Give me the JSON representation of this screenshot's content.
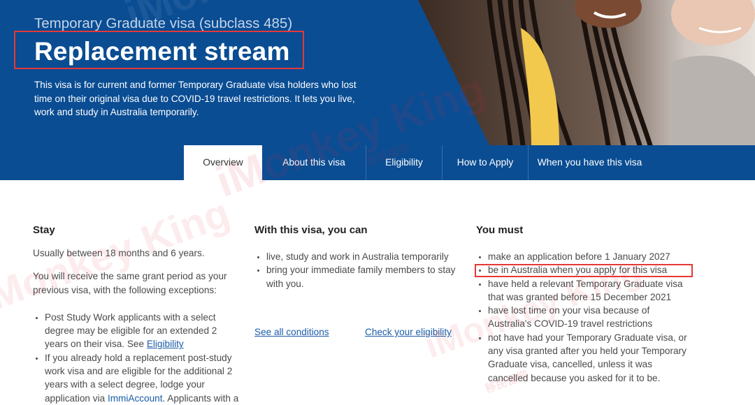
{
  "hero": {
    "subtitle": "Temporary Graduate visa (subclass 485)",
    "title": "Replacement stream",
    "description": "This visa is for current and former Temporary Graduate visa holders who lost time on their original visa due to COVID-19 travel restrictions. It lets you live, work and study in Australia temporarily."
  },
  "tabs": [
    {
      "label": "Overview",
      "active": true
    },
    {
      "label": "About this visa",
      "active": false
    },
    {
      "label": "Eligibility",
      "active": false
    },
    {
      "label": "How to Apply",
      "active": false
    },
    {
      "label": "When you have this visa",
      "active": false
    }
  ],
  "stay": {
    "heading": "Stay",
    "duration": "Usually between 18 months and 6 years.",
    "grant_period": "You will receive the same grant period as your previous visa, with the following exceptions:",
    "items": [
      {
        "text": "Post Study Work applicants with a select degree may be eligible for an extended 2 years on their visa. See ",
        "link": "Eligibility"
      },
      {
        "text": "If you already hold a replacement post-study work visa and are eligible for the additional 2 years with a select degree, lodge your application via ",
        "link": "ImmiAccount",
        "after": ". Applicants with a"
      }
    ]
  },
  "with_visa": {
    "heading": "With this visa, you can",
    "items": [
      "live, study and work in Australia temporarily",
      "bring your immediate family members to stay with you."
    ],
    "see_all_link": "See all conditions",
    "check_eligibility_link": "Check your eligibility"
  },
  "you_must": {
    "heading": "You must",
    "items": [
      "make an application before 1 January 2027",
      "be in Australia when you apply for this visa",
      "have held a relevant Temporary Graduate visa that was granted before 15 December 2021",
      "have lost time on your visa because of Australia's COVID-19 travel restrictions",
      "not have had your Temporary Graduate visa, or any visa granted after you held your Temporary Graduate visa, cancelled, unless it was cancelled because you asked for it to be."
    ]
  },
  "colors": {
    "hero_blue": "#0a4d93",
    "annotation_red": "#e53935",
    "link_blue": "#1a5ca8"
  },
  "watermark": {
    "brand": "iMonkey King",
    "chinese": "移民留学"
  }
}
